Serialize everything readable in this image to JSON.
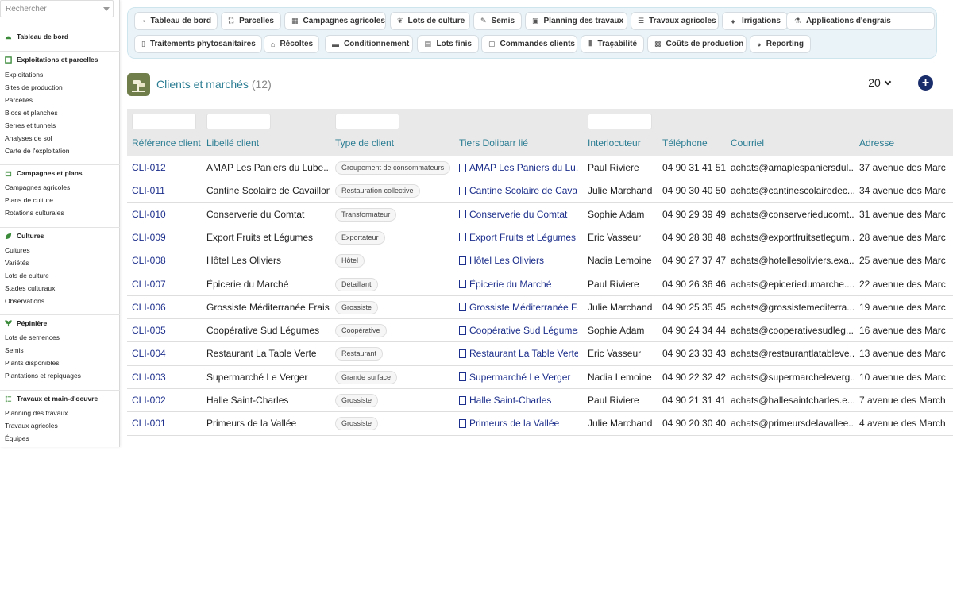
{
  "search": {
    "placeholder": "Rechercher"
  },
  "sidebar": {
    "dashboard": "Tableau de bord",
    "sections": [
      {
        "title": "Exploitations et parcelles",
        "icon": "map-icon",
        "items": [
          "Exploitations",
          "Sites de production",
          "Parcelles",
          "Blocs et planches",
          "Serres et tunnels",
          "Analyses de sol",
          "Carte de l'exploitation"
        ]
      },
      {
        "title": "Campagnes et plans",
        "icon": "calendar-icon",
        "items": [
          "Campagnes agricoles",
          "Plans de culture",
          "Rotations culturales"
        ]
      },
      {
        "title": "Cultures",
        "icon": "leaf-icon",
        "items": [
          "Cultures",
          "Variétés",
          "Lots de culture",
          "Stades culturaux",
          "Observations"
        ]
      },
      {
        "title": "Pépinière",
        "icon": "sprout-icon",
        "items": [
          "Lots de semences",
          "Semis",
          "Plants disponibles",
          "Plantations et repiquages"
        ]
      },
      {
        "title": "Travaux et main-d'oeuvre",
        "icon": "list-icon",
        "items": [
          "Planning des travaux",
          "Travaux agricoles",
          "Équipes"
        ]
      }
    ]
  },
  "tabs_row1": [
    {
      "label": "Tableau de bord",
      "icon": "dashboard-icon",
      "glyph": "◔"
    },
    {
      "label": "Parcelles",
      "icon": "parcel-icon",
      "glyph": "⛶"
    },
    {
      "label": "Campagnes agricoles",
      "icon": "calendar-icon",
      "glyph": "▦"
    },
    {
      "label": "Lots de culture",
      "icon": "sprout-icon",
      "glyph": "❦"
    },
    {
      "label": "Semis",
      "icon": "seed-icon",
      "glyph": "✎"
    },
    {
      "label": "Planning des travaux",
      "icon": "calendar-check-icon",
      "glyph": "▣"
    },
    {
      "label": "Travaux agricoles",
      "icon": "list-icon",
      "glyph": "☰"
    },
    {
      "label": "Irrigations",
      "icon": "droplet-icon",
      "glyph": "♦"
    },
    {
      "label": "Applications d'engrais",
      "icon": "flask-icon",
      "glyph": "⚗"
    }
  ],
  "tabs_row2": [
    {
      "label": "Traitements phytosanitaires",
      "icon": "spray-icon",
      "glyph": "▯"
    },
    {
      "label": "Récoltes",
      "icon": "basket-icon",
      "glyph": "⌂"
    },
    {
      "label": "Conditionnement",
      "icon": "box-icon",
      "glyph": "▬"
    },
    {
      "label": "Lots finis",
      "icon": "boxes-icon",
      "glyph": "▤"
    },
    {
      "label": "Commandes clients",
      "icon": "document-icon",
      "glyph": "▢"
    },
    {
      "label": "Traçabilité",
      "icon": "barcode-icon",
      "glyph": "⦀"
    },
    {
      "label": "Coûts de production",
      "icon": "money-icon",
      "glyph": "▩"
    },
    {
      "label": "Reporting",
      "icon": "pie-chart-icon",
      "glyph": "◕"
    }
  ],
  "page": {
    "title": "Clients et marchés",
    "count": "(12)",
    "per_page": "20",
    "add_label": "+"
  },
  "columns": [
    "Référence client",
    "Libellé client",
    "Type de client",
    "Tiers Dolibarr lié",
    "Interlocuteur",
    "Téléphone",
    "Courriel",
    "Adresse"
  ],
  "rows": [
    {
      "ref": "CLI-012",
      "label": "AMAP Les Paniers du Lube...",
      "type": "Groupement de consommateurs",
      "tiers": "AMAP Les Paniers du Lu...",
      "contact": "Paul Riviere",
      "phone": "04 90 31 41 51",
      "email": "achats@amaplespaniersdul...",
      "address": "37 avenue des Marc"
    },
    {
      "ref": "CLI-011",
      "label": "Cantine Scolaire de Cavaillon",
      "type": "Restauration collective",
      "tiers": "Cantine Scolaire de Cava...",
      "contact": "Julie Marchand",
      "phone": "04 90 30 40 50",
      "email": "achats@cantinescolairedec...",
      "address": "34 avenue des Marc"
    },
    {
      "ref": "CLI-010",
      "label": "Conserverie du Comtat",
      "type": "Transformateur",
      "tiers": "Conserverie du Comtat",
      "contact": "Sophie Adam",
      "phone": "04 90 29 39 49",
      "email": "achats@conserverieducomt...",
      "address": "31 avenue des Marc"
    },
    {
      "ref": "CLI-009",
      "label": "Export Fruits et Légumes",
      "type": "Exportateur",
      "tiers": "Export Fruits et Légumes",
      "contact": "Eric Vasseur",
      "phone": "04 90 28 38 48",
      "email": "achats@exportfruitsetlegum...",
      "address": "28 avenue des Marc"
    },
    {
      "ref": "CLI-008",
      "label": "Hôtel Les Oliviers",
      "type": "Hôtel",
      "tiers": "Hôtel Les Oliviers",
      "contact": "Nadia Lemoine",
      "phone": "04 90 27 37 47",
      "email": "achats@hotellesoliviers.exa...",
      "address": "25 avenue des Marc"
    },
    {
      "ref": "CLI-007",
      "label": "Épicerie du Marché",
      "type": "Détaillant",
      "tiers": "Épicerie du Marché",
      "contact": "Paul Riviere",
      "phone": "04 90 26 36 46",
      "email": "achats@epiceriedumarche....",
      "address": "22 avenue des Marc"
    },
    {
      "ref": "CLI-006",
      "label": "Grossiste Méditerranée Frais",
      "type": "Grossiste",
      "tiers": "Grossiste Méditerranée F...",
      "contact": "Julie Marchand",
      "phone": "04 90 25 35 45",
      "email": "achats@grossistemediterra...",
      "address": "19 avenue des Marc"
    },
    {
      "ref": "CLI-005",
      "label": "Coopérative Sud Légumes",
      "type": "Coopérative",
      "tiers": "Coopérative Sud Légumes",
      "contact": "Sophie Adam",
      "phone": "04 90 24 34 44",
      "email": "achats@cooperativesudleg...",
      "address": "16 avenue des Marc"
    },
    {
      "ref": "CLI-004",
      "label": "Restaurant La Table Verte",
      "type": "Restaurant",
      "tiers": "Restaurant La Table Verte",
      "contact": "Eric Vasseur",
      "phone": "04 90 23 33 43",
      "email": "achats@restaurantlatableve...",
      "address": "13 avenue des Marc"
    },
    {
      "ref": "CLI-003",
      "label": "Supermarché Le Verger",
      "type": "Grande surface",
      "tiers": "Supermarché Le Verger",
      "contact": "Nadia Lemoine",
      "phone": "04 90 22 32 42",
      "email": "achats@supermarcheleverg...",
      "address": "10 avenue des Marc"
    },
    {
      "ref": "CLI-002",
      "label": "Halle Saint-Charles",
      "type": "Grossiste",
      "tiers": "Halle Saint-Charles",
      "contact": "Paul Riviere",
      "phone": "04 90 21 31 41",
      "email": "achats@hallesaintcharles.e...",
      "address": "7 avenue des March"
    },
    {
      "ref": "CLI-001",
      "label": "Primeurs de la Vallée",
      "type": "Grossiste",
      "tiers": "Primeurs de la Vallée",
      "contact": "Julie Marchand",
      "phone": "04 90 20 30 40",
      "email": "achats@primeursdelavallee....",
      "address": "4 avenue des March"
    }
  ]
}
